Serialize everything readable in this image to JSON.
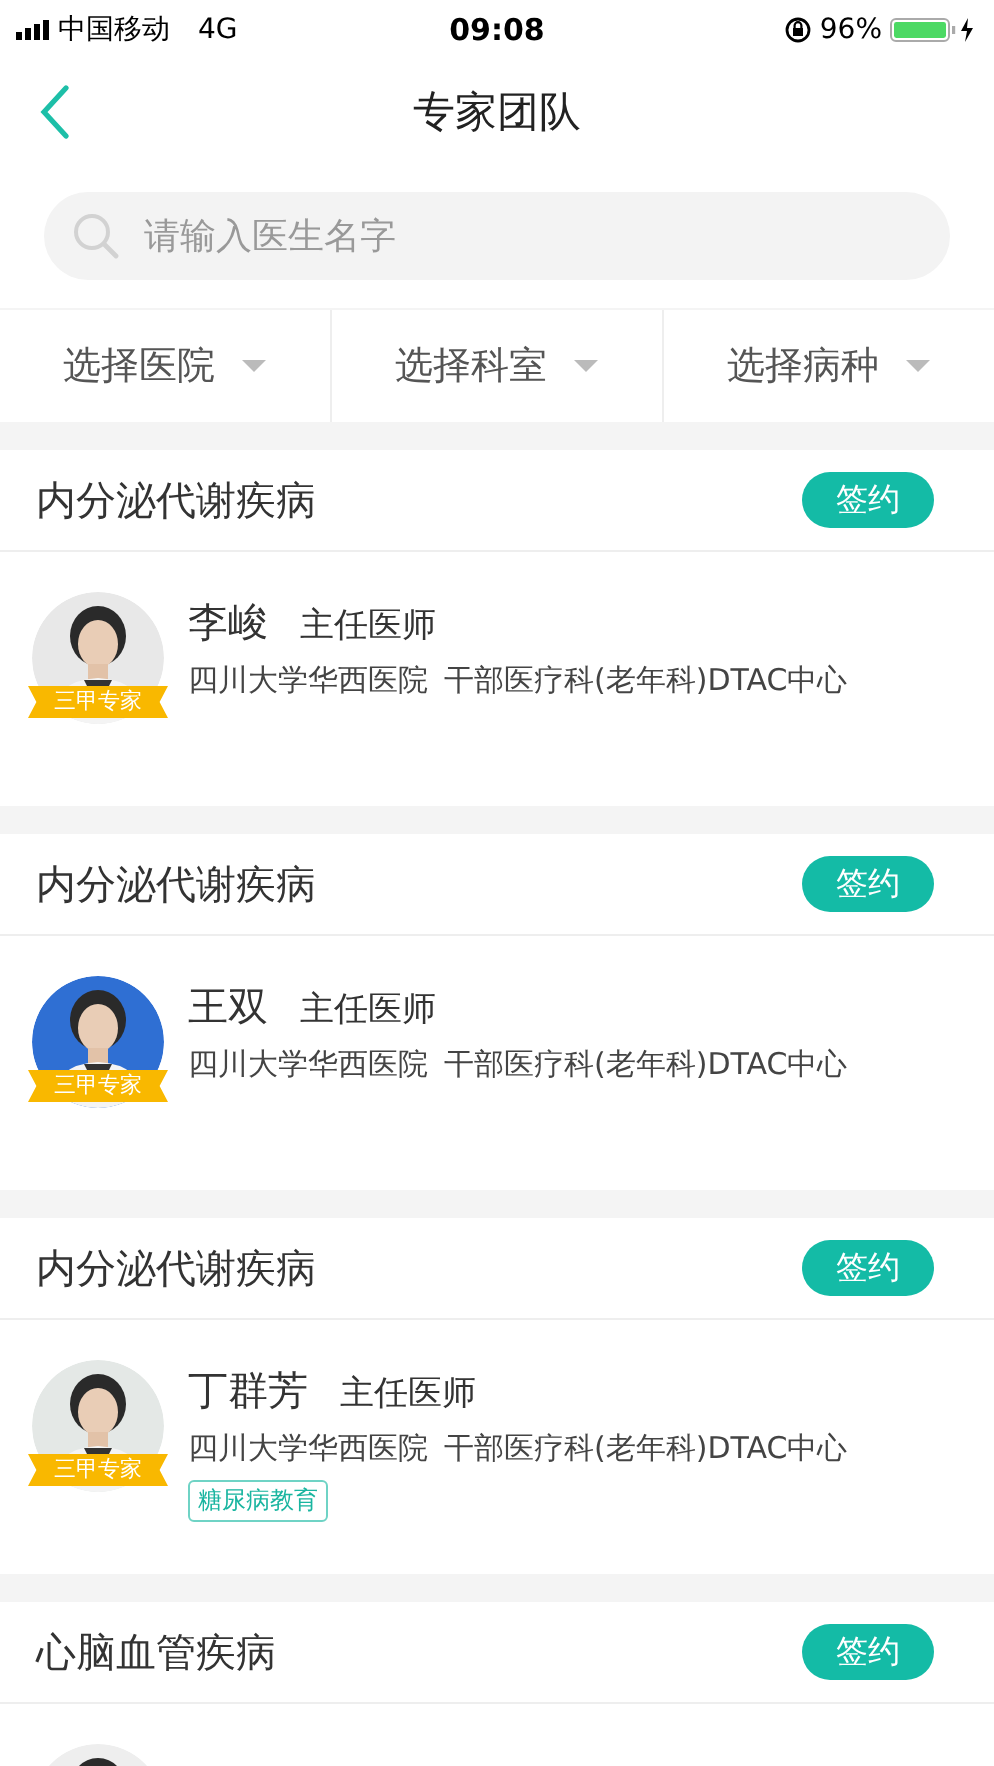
{
  "status_bar": {
    "carrier": "中国移动",
    "network": "4G",
    "time": "09:08",
    "battery": "96%"
  },
  "nav": {
    "title": "专家团队"
  },
  "search": {
    "placeholder": "请输入医生名字"
  },
  "filters": [
    {
      "label": "选择医院"
    },
    {
      "label": "选择科室"
    },
    {
      "label": "选择病种"
    }
  ],
  "experts": [
    {
      "category": "内分泌代谢疾病",
      "sign_button": "签约",
      "name": "李峻",
      "title": "主任医师",
      "hospital": "四川大学华西医院",
      "department": "干部医疗科(老年科)DTAC中心",
      "badge": "三甲专家"
    },
    {
      "category": "内分泌代谢疾病",
      "sign_button": "签约",
      "name": "王双",
      "title": "主任医师",
      "hospital": "四川大学华西医院",
      "department": "干部医疗科(老年科)DTAC中心",
      "badge": "三甲专家"
    },
    {
      "category": "内分泌代谢疾病",
      "sign_button": "签约",
      "name": "丁群芳",
      "title": "主任医师",
      "hospital": "四川大学华西医院",
      "department": "干部医疗科(老年科)DTAC中心",
      "badge": "三甲专家",
      "tags": [
        "糖尿病教育"
      ]
    },
    {
      "category": "心脑血管疾病",
      "sign_button": "签约"
    }
  ]
}
